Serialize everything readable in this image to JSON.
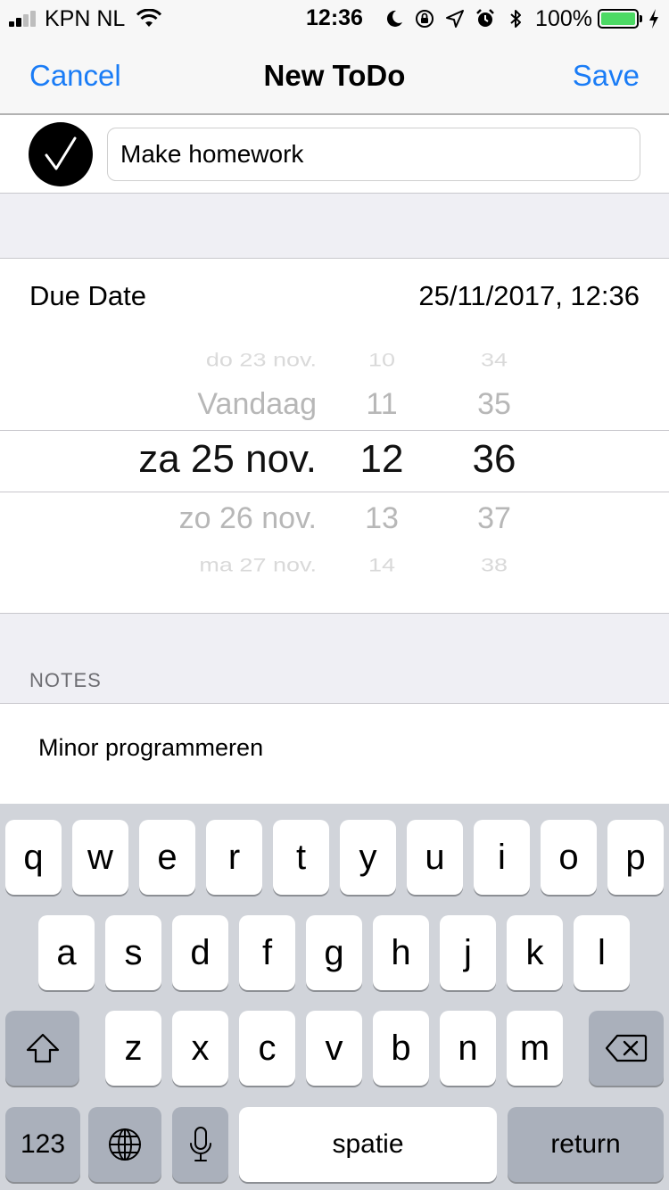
{
  "status_bar": {
    "carrier": "KPN NL",
    "time": "12:36",
    "battery_percent": "100%",
    "signal_bars_filled": 2,
    "signal_bars_total": 4,
    "battery_level": 1.0,
    "battery_color": "#4cd964",
    "icons": [
      "moon-icon",
      "orientation-lock-icon",
      "location-icon",
      "alarm-icon",
      "bluetooth-icon",
      "charging-icon"
    ]
  },
  "navbar": {
    "cancel_label": "Cancel",
    "title": "New ToDo",
    "save_label": "Save",
    "accent_color": "#1a7cf6"
  },
  "todo": {
    "title_value": "Make homework",
    "completed": true
  },
  "due_date": {
    "label": "Due Date",
    "value": "25/11/2017, 12:36"
  },
  "picker": {
    "dates": [
      "do 23 nov.",
      "Vandaag",
      "za 25 nov.",
      "zo 26 nov.",
      "ma 27 nov."
    ],
    "hours": [
      "10",
      "11",
      "12",
      "13",
      "14"
    ],
    "minutes": [
      "34",
      "35",
      "36",
      "37",
      "38"
    ]
  },
  "notes": {
    "header": "NOTES",
    "text": "Minor programmeren"
  },
  "keyboard": {
    "row1": [
      "q",
      "w",
      "e",
      "r",
      "t",
      "y",
      "u",
      "i",
      "o",
      "p"
    ],
    "row2": [
      "a",
      "s",
      "d",
      "f",
      "g",
      "h",
      "j",
      "k",
      "l"
    ],
    "row3": [
      "z",
      "x",
      "c",
      "v",
      "b",
      "n",
      "m"
    ],
    "numbers_label": "123",
    "space_label": "spatie",
    "return_label": "return"
  }
}
